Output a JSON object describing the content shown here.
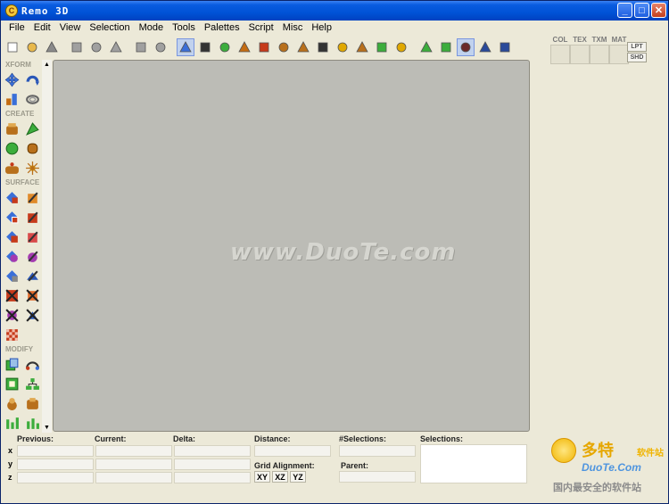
{
  "window": {
    "title": "Remo 3D",
    "minimize": "_",
    "maximize": "□",
    "close": "✕"
  },
  "menu": [
    "File",
    "Edit",
    "View",
    "Selection",
    "Mode",
    "Tools",
    "Palettes",
    "Script",
    "Misc",
    "Help"
  ],
  "toolbar": {
    "tools": [
      {
        "name": "new-icon",
        "color": "#ffffff"
      },
      {
        "name": "open-icon",
        "color": "#e8b84a"
      },
      {
        "name": "save-icon",
        "color": "#8a8a8a"
      },
      {
        "name": "cut-icon",
        "color": "#a0a0a0"
      },
      {
        "name": "copy-icon",
        "color": "#a0a0a0"
      },
      {
        "name": "paste-icon",
        "color": "#a0a0a0"
      },
      {
        "name": "undo-icon",
        "color": "#a0a0a0"
      },
      {
        "name": "redo-icon",
        "color": "#a0a0a0"
      },
      {
        "name": "select-vertex-icon",
        "color": "#3a6fd8"
      },
      {
        "name": "select-edge-icon",
        "color": "#333333"
      },
      {
        "name": "select-face-icon",
        "color": "#3cad3c"
      },
      {
        "name": "select-object-icon",
        "color": "#c46c12"
      },
      {
        "name": "select-group-icon",
        "color": "#c63a1a"
      },
      {
        "name": "select-lod-icon",
        "color": "#b8701c"
      },
      {
        "name": "select-switch-icon",
        "color": "#b8701c"
      },
      {
        "name": "select-tree-icon",
        "color": "#333333"
      },
      {
        "name": "light-icon",
        "color": "#e0a800"
      },
      {
        "name": "dof-icon",
        "color": "#b8701c"
      },
      {
        "name": "wireframe-icon",
        "color": "#3cad3c"
      },
      {
        "name": "star-icon",
        "color": "#e0a800"
      },
      {
        "name": "move-icon",
        "color": "#3cad3c"
      },
      {
        "name": "scale-icon",
        "color": "#3cad3c"
      },
      {
        "name": "grid-icon",
        "color": "#6a2a2a"
      },
      {
        "name": "sigma-icon",
        "color": "#2a4a9a"
      },
      {
        "name": "triangle-icon",
        "color": "#2a4a9a"
      }
    ]
  },
  "right_panel": {
    "labels": [
      "COL",
      "TEX",
      "TXM",
      "MAT"
    ],
    "buttons": [
      "LPT",
      "SHD"
    ]
  },
  "palette": {
    "sections": [
      "XFORM",
      "CREATE",
      "SURFACE",
      "MODIFY"
    ]
  },
  "viewport": {
    "watermark": "www.DuoTe.com"
  },
  "bottom": {
    "previous": "Previous:",
    "current": "Current:",
    "delta": "Delta:",
    "distance": "Distance:",
    "selections_count": "#Selections:",
    "selections": "Selections:",
    "grid_alignment": "Grid Alignment:",
    "parent": "Parent:",
    "axes": [
      "x",
      "y",
      "z"
    ],
    "grid_buttons": [
      "XY",
      "XZ",
      "YZ"
    ]
  },
  "logo": {
    "cn": "多特",
    "sub": "软件站",
    "en": "DuoTe.Com",
    "tag": "国内最安全的软件站"
  }
}
